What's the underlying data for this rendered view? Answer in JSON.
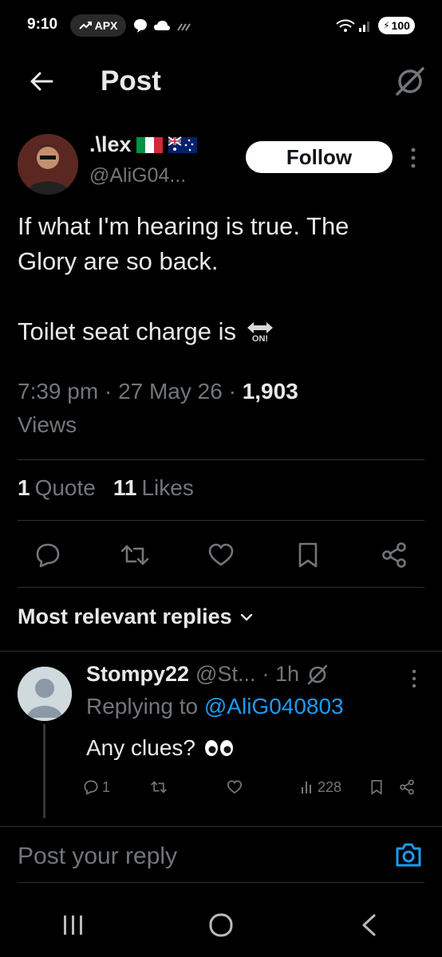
{
  "status_bar": {
    "time": "9:10",
    "apx_label": "APX",
    "battery": "100"
  },
  "header": {
    "title": "Post"
  },
  "post": {
    "author": {
      "display_name": ".\\lex",
      "handle": "@AliG04..."
    },
    "follow_label": "Follow",
    "text_lines": [
      "If what I'm hearing is true. The",
      "Glory are so back."
    ],
    "text_line3": "Toilet seat charge is",
    "emoji_label": "ON!",
    "time": "7:39 pm",
    "dot": "·",
    "date": "27 May 26",
    "views_count": "1,903",
    "views_label": "Views",
    "quote_count": "1",
    "quote_label": "Quote",
    "likes_count": "11",
    "likes_label": "Likes"
  },
  "replies_section": {
    "title": "Most relevant replies"
  },
  "reply": {
    "name": "Stompy22",
    "handle": "@St...",
    "time": "· 1h",
    "replying_prefix": "Replying to",
    "replying_to": "@AliG040803",
    "text": "Any clues?",
    "reply_count": "1",
    "view_count": "228"
  },
  "compose": {
    "placeholder": "Post your reply"
  },
  "colors": {
    "background": "#000000",
    "text": "#e7e9ea",
    "muted": "#71767b",
    "link": "#1d9bf0",
    "divider": "#2f3336"
  }
}
